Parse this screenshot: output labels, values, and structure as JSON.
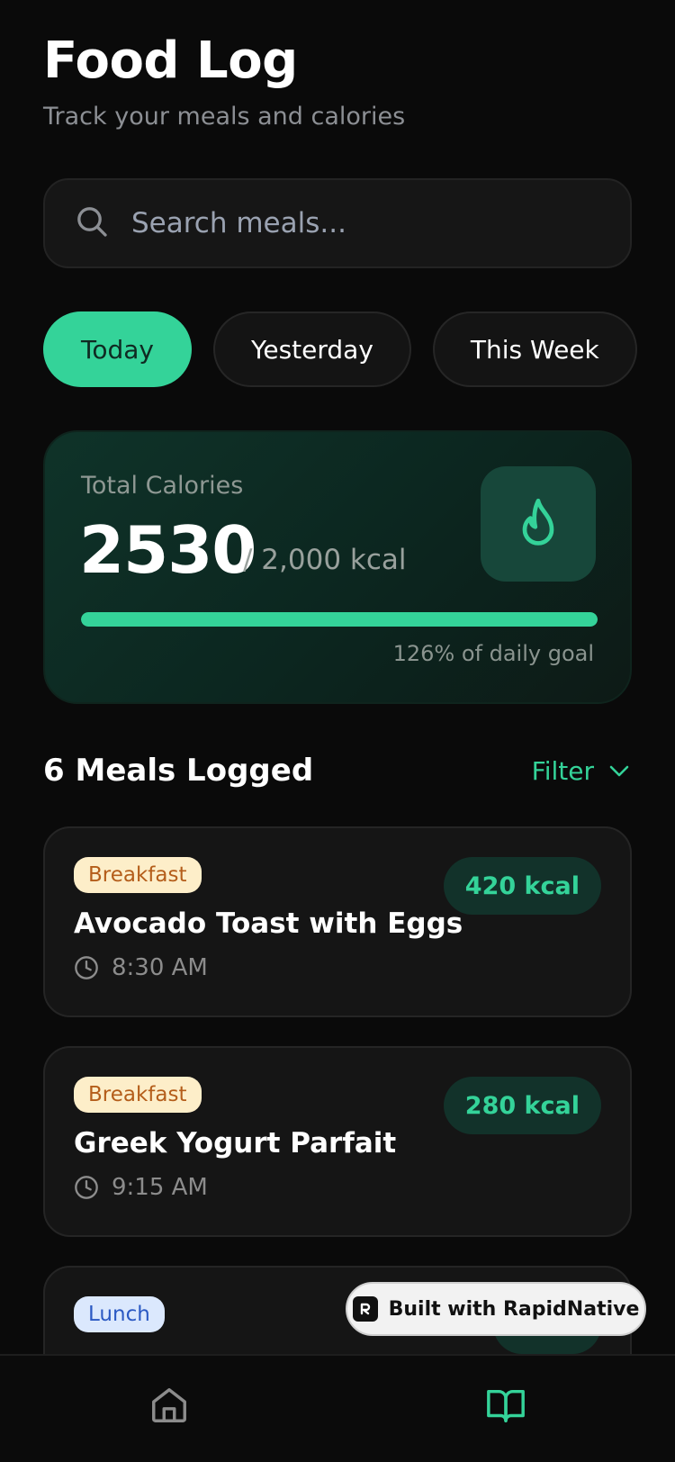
{
  "header": {
    "title": "Food Log",
    "subtitle": "Track your meals and calories"
  },
  "search": {
    "placeholder": "Search meals...",
    "icon": "search-icon"
  },
  "tabs": [
    {
      "label": "Today",
      "active": true
    },
    {
      "label": "Yesterday",
      "active": false
    },
    {
      "label": "This Week",
      "active": false
    }
  ],
  "calories": {
    "label": "Total Calories",
    "value": "2530",
    "goal": "/ 2,000 kcal",
    "percent_text": "126% of daily goal",
    "progress_fraction": 1.0,
    "icon": "flame-icon"
  },
  "meals_section": {
    "title": "6 Meals Logged",
    "filter_label": "Filter"
  },
  "meals": [
    {
      "category": "Breakfast",
      "name": "Avocado Toast with Eggs",
      "time": "8:30 AM",
      "kcal": "420 kcal"
    },
    {
      "category": "Breakfast",
      "name": "Greek Yogurt Parfait",
      "time": "9:15 AM",
      "kcal": "280 kcal"
    },
    {
      "category": "Lunch"
    }
  ],
  "badge": {
    "label": "Built with RapidNative"
  },
  "colors": {
    "accent": "#34d399",
    "background": "#0a0a0a",
    "card": "#151515"
  },
  "nav": [
    {
      "icon": "home-icon",
      "active": false
    },
    {
      "icon": "book-open-icon",
      "active": true
    }
  ]
}
